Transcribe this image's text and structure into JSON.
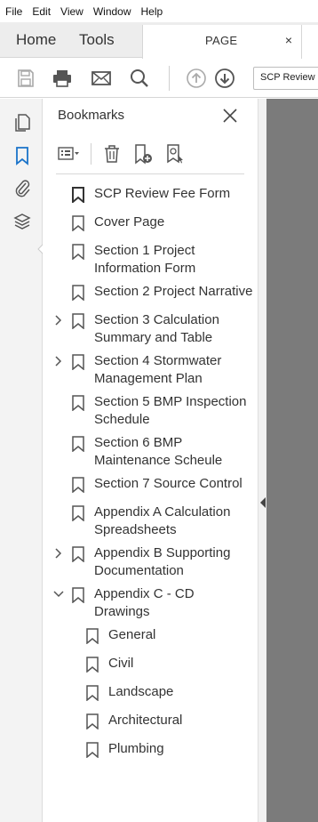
{
  "menubar": {
    "items": [
      "File",
      "Edit",
      "View",
      "Window",
      "Help"
    ]
  },
  "tabs": {
    "home": "Home",
    "tools": "Tools",
    "document": "PAGE",
    "close": "×"
  },
  "toolbar": {
    "icons": [
      "save-icon",
      "print-icon",
      "email-icon",
      "search-icon",
      "page-up-icon",
      "page-down-icon"
    ],
    "doc_field_value": "SCP Review"
  },
  "rail": {
    "icons": [
      "pages-icon",
      "bookmark-icon",
      "attachment-icon",
      "layers-icon"
    ]
  },
  "bookmarks_panel": {
    "title": "Bookmarks",
    "tool_icons": [
      "options-menu-icon",
      "delete-icon",
      "new-bookmark-icon",
      "bookmark-search-icon"
    ],
    "items": [
      {
        "lines": [
          "SCP Review Fee Form",
          ""
        ],
        "expandable": "none",
        "active": true
      },
      {
        "lines": [
          "Cover Page",
          ""
        ],
        "expandable": "none"
      },
      {
        "lines": [
          "Section 1 Project",
          "Information Form"
        ],
        "expandable": "none"
      },
      {
        "lines": [
          "Section 2 Project Narrative",
          ""
        ],
        "expandable": "none"
      },
      {
        "lines": [
          "Section 3 Calculation",
          "Summary and Table"
        ],
        "expandable": "collapsed"
      },
      {
        "lines": [
          "Section 4 Stormwater",
          "Management Plan"
        ],
        "expandable": "collapsed"
      },
      {
        "lines": [
          "Section 5 BMP Inspection",
          "Schedule"
        ],
        "expandable": "none"
      },
      {
        "lines": [
          "Section 6 BMP",
          "Maintenance Scheule"
        ],
        "expandable": "none"
      },
      {
        "lines": [
          "Section 7 Source Control",
          ""
        ],
        "expandable": "none"
      },
      {
        "lines": [
          "Appendix A Calculation",
          "Spreadsheets"
        ],
        "expandable": "none"
      },
      {
        "lines": [
          "Appendix B Supporting",
          "Documentation"
        ],
        "expandable": "collapsed"
      },
      {
        "lines": [
          "Appendix C - CD",
          "Drawings"
        ],
        "expandable": "expanded"
      },
      {
        "lines": [
          "General",
          ""
        ],
        "expandable": "none",
        "child": true
      },
      {
        "lines": [
          "Civil",
          ""
        ],
        "expandable": "none",
        "child": true
      },
      {
        "lines": [
          "Landscape",
          ""
        ],
        "expandable": "none",
        "child": true
      },
      {
        "lines": [
          "Architectural",
          ""
        ],
        "expandable": "none",
        "child": true
      },
      {
        "lines": [
          "Plumbing",
          ""
        ],
        "expandable": "none",
        "child": true
      }
    ]
  },
  "colors": {
    "accent": "#1a73c9",
    "doc_background": "#7b7b7b",
    "icon_gray": "#666666"
  }
}
